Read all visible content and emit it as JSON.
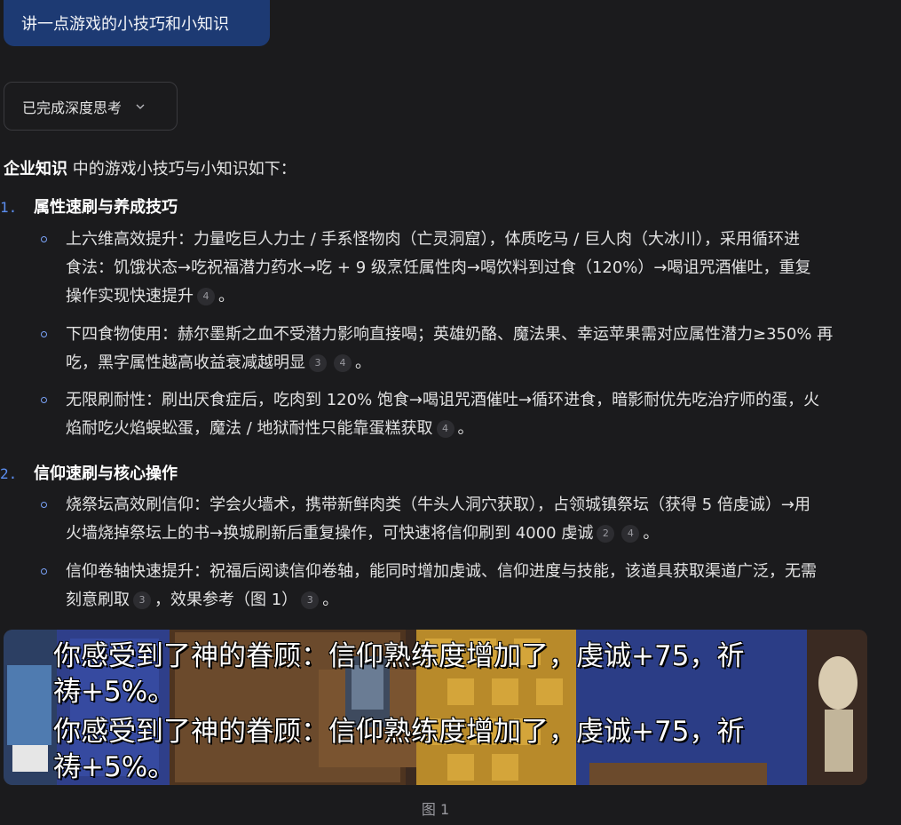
{
  "user_message": "讲一点游戏的小技巧和小知识",
  "thinking": {
    "label": "已完成深度思考",
    "icon": "chevron-down-icon"
  },
  "intro": {
    "bold": "企业知识",
    "rest": " 中的游戏小技巧与小知识如下："
  },
  "sections": [
    {
      "number": "1.",
      "title": "属性速刷与养成技巧",
      "bullets": [
        {
          "lines": [
            "上六维高效提升：力量吃巨人力士 / 手系怪物肉（亡灵洞窟），体质吃马 / 巨人肉（大冰川），采用循环进",
            "食法：饥饿状态→吃祝福潜力药水→吃 + 9 级烹饪属性肉→喝饮料到过食（120%）→喝诅咒酒催吐，重复",
            "操作实现快速提升"
          ],
          "cites": [
            "4"
          ],
          "end": "。"
        },
        {
          "lines": [
            "下四食物使用：赫尔墨斯之血不受潜力影响直接喝；英雄奶酪、魔法果、幸运苹果需对应属性潜力≥350% 再",
            "吃，黑字属性越高收益衰减越明显"
          ],
          "cites": [
            "3",
            "4"
          ],
          "end": "。"
        },
        {
          "lines": [
            "无限刷耐性：刷出厌食症后，吃肉到 120% 饱食→喝诅咒酒催吐→循环进食，暗影耐优先吃治疗师的蛋，火",
            "焰耐吃火焰蜈蚣蛋，魔法 / 地狱耐性只能靠蛋糕获取"
          ],
          "cites": [
            "4"
          ],
          "end": "。"
        }
      ]
    },
    {
      "number": "2.",
      "title": "信仰速刷与核心操作",
      "bullets": [
        {
          "lines": [
            "烧祭坛高效刷信仰：学会火墙术，携带新鲜肉类（牛头人洞穴获取），占领城镇祭坛（获得 5 倍虔诚）→用",
            "火墙烧掉祭坛上的书→换城刷新后重复操作，可快速将信仰刷到 4000 虔诚"
          ],
          "cites": [
            "2",
            "4"
          ],
          "end": "。"
        },
        {
          "lines": [
            "信仰卷轴快速提升：祝福后阅读信仰卷轴，能同时增加虔诚、信仰进度与技能，该道具获取渠道广泛，无需",
            "刻意刷取"
          ],
          "cites": [
            "3"
          ],
          "mid": "，效果参考（图 1）",
          "cites2": [
            "3"
          ],
          "end": "。"
        }
      ]
    }
  ],
  "figure": {
    "lines": [
      "你感受到了神的眷顾：信仰熟练度增加了，虔诚+75，祈",
      "祷+5%。",
      "你感受到了神的眷顾：信仰熟练度增加了，虔诚+75，祈",
      "祷+5%。"
    ],
    "caption": "图 1"
  }
}
